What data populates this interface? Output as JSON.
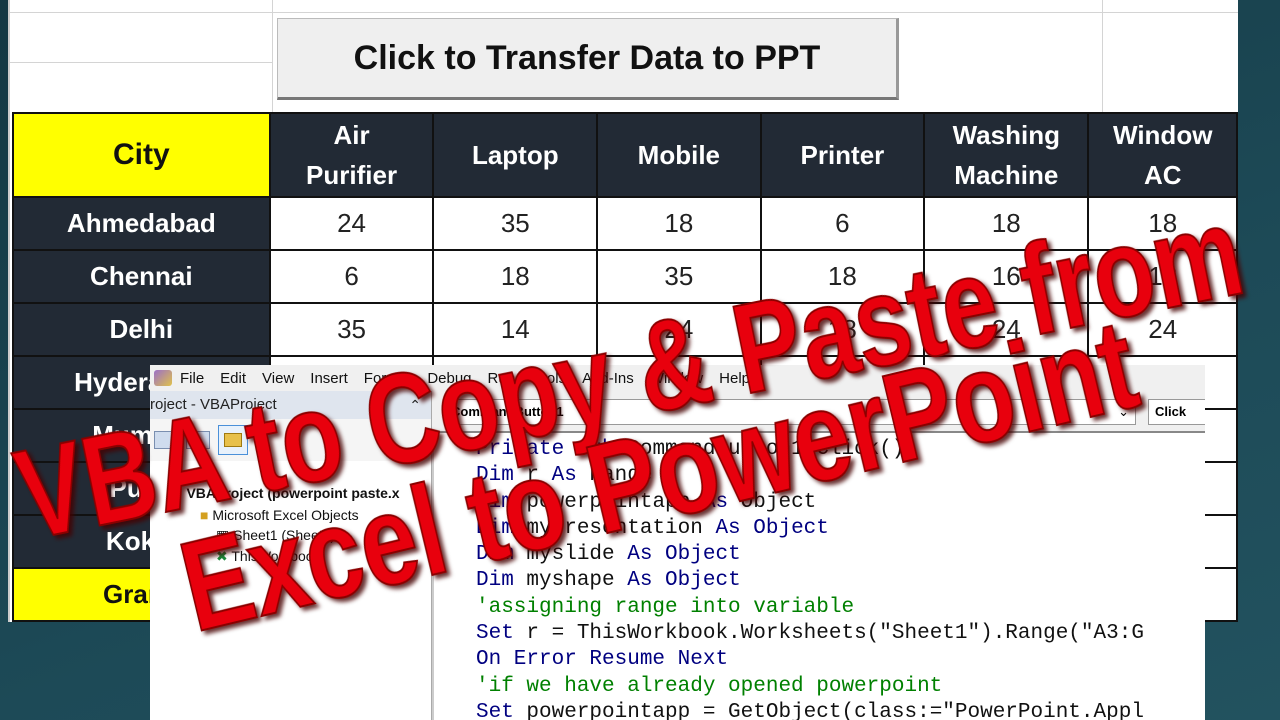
{
  "excel": {
    "button_label": "Click to Transfer Data to PPT",
    "headers": [
      "City",
      "Air Purifier",
      "Laptop",
      "Mobile",
      "Printer",
      "Washing Machine",
      "Window AC"
    ],
    "header_lines": [
      [
        "City"
      ],
      [
        "Air",
        "Purifier"
      ],
      [
        "Laptop"
      ],
      [
        "Mobile"
      ],
      [
        "Printer"
      ],
      [
        "Washing",
        "Machine"
      ],
      [
        "Window",
        "AC"
      ]
    ],
    "rows": [
      {
        "city": "Ahmedabad",
        "values": [
          "24",
          "35",
          "18",
          "6",
          "18",
          "18"
        ]
      },
      {
        "city": "Chennai",
        "values": [
          "6",
          "18",
          "35",
          "18",
          "16",
          "18"
        ]
      },
      {
        "city": "Delhi",
        "values": [
          "35",
          "14",
          "24",
          "18",
          "24",
          "24"
        ]
      },
      {
        "city": "Hyderabad",
        "values": [
          "",
          "",
          "",
          "",
          "",
          ""
        ]
      },
      {
        "city": "Mumbai",
        "values": [
          "",
          "",
          "",
          "",
          "",
          ""
        ]
      },
      {
        "city": "Pune",
        "values": [
          "",
          "",
          "",
          "",
          "",
          ""
        ]
      },
      {
        "city": "Kokla",
        "values": [
          "",
          "",
          "",
          "",
          "",
          ""
        ]
      }
    ],
    "grand_total_label": "Grand",
    "colors": {
      "header_bg": "#222a35",
      "city_header_bg": "#ffff00"
    }
  },
  "vbe": {
    "menu": [
      "File",
      "Edit",
      "View",
      "Insert",
      "Format",
      "Debug",
      "Run",
      "Tools",
      "Add-Ins",
      "Window",
      "Help"
    ],
    "project_title": "roject - VBAProject",
    "tree": {
      "root": "VBAProject (powerpoint paste.x",
      "folder": "Microsoft Excel Objects",
      "sheet": "Sheet1 (Sheet1)",
      "workbook": "ThisWorkbook"
    },
    "object_dropdown": "CommandButton1",
    "proc_dropdown": "Click",
    "code": [
      [
        [
          "kw",
          "Private Sub "
        ],
        [
          "",
          "CommandButton1_Click()"
        ]
      ],
      [
        [
          "kw",
          "Dim "
        ],
        [
          "",
          "r "
        ],
        [
          "kw",
          "As "
        ],
        [
          "",
          "Range"
        ]
      ],
      [
        [
          "kw",
          "Dim "
        ],
        [
          "",
          "powerpointapp "
        ],
        [
          "kw",
          "As "
        ],
        [
          "",
          "Object"
        ]
      ],
      [
        [
          "kw",
          "Dim "
        ],
        [
          "",
          "mypresentation "
        ],
        [
          "kw",
          "As "
        ],
        [
          "kw",
          "Object"
        ]
      ],
      [
        [
          "kw",
          "Dim "
        ],
        [
          "",
          "myslide "
        ],
        [
          "kw",
          "As Object"
        ]
      ],
      [
        [
          "kw",
          "Dim "
        ],
        [
          "",
          "myshape "
        ],
        [
          "kw",
          "As Object"
        ]
      ],
      [
        [
          "cm",
          "'assigning range into variable"
        ]
      ],
      [
        [
          "kw",
          "Set "
        ],
        [
          "",
          "r = ThisWorkbook.Worksheets(\"Sheet1\").Range(\"A3:G"
        ]
      ],
      [
        [
          "kw",
          "On Error Resume Next"
        ]
      ],
      [
        [
          "cm",
          "'if we have already opened powerpoint"
        ]
      ],
      [
        [
          "kw",
          "Set "
        ],
        [
          "",
          "powerpointapp = GetObject(class:=\"PowerPoint.Appl"
        ]
      ]
    ]
  },
  "overlay": {
    "line1": "VBA to Copy & Paste from",
    "line2": "Excel to PowerPoint",
    "color": "#e8000a"
  }
}
